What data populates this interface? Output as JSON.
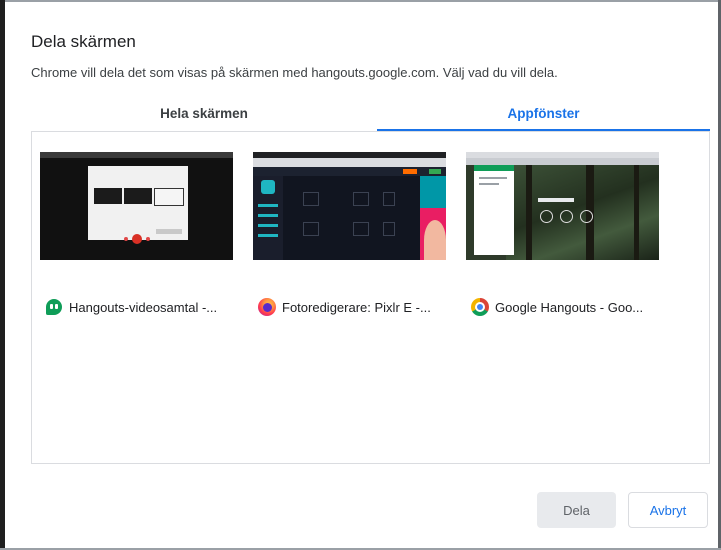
{
  "dialog": {
    "title": "Dela skärmen",
    "description": "Chrome vill dela det som visas på skärmen med hangouts.google.com. Välj vad du vill dela."
  },
  "tabs": [
    {
      "label": "Hela skärmen",
      "selected": false
    },
    {
      "label": "Appfönster",
      "selected": true
    }
  ],
  "windows": [
    {
      "label": "Hangouts-videosamtal -...",
      "icon": "hangouts-icon"
    },
    {
      "label": "Fotoredigerare: Pixlr E -...",
      "icon": "firefox-icon"
    },
    {
      "label": "Google Hangouts - Goo...",
      "icon": "chrome-icon"
    }
  ],
  "buttons": {
    "share": "Dela",
    "cancel": "Avbryt"
  },
  "colors": {
    "accent": "#1a73e8",
    "disabled_bg": "#e8eaed",
    "border": "#dadce0"
  }
}
